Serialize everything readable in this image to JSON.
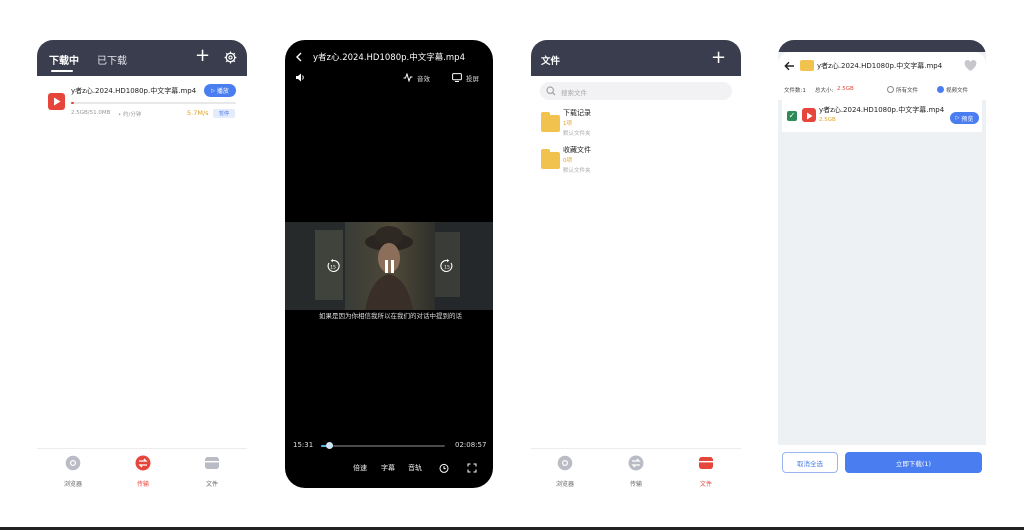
{
  "phone1": {
    "tabs": [
      "下载中",
      "已下载"
    ],
    "item": {
      "title": "y者z心.2024.HD1080p.中文字幕.mp4",
      "size": "2.5GB/51.0MB",
      "eta": "• 约/分钟",
      "speed": "5.7M/s",
      "play_label": "播放",
      "pause_label": "暂停",
      "progress": 0.02
    },
    "nav": [
      "浏览器",
      "传输",
      "文件"
    ]
  },
  "phone2": {
    "title": "y者z心.2024.HD1080p.中文字幕.mp4",
    "audio_label": "音效",
    "cast_label": "投屏",
    "subtitle": "如果是因为你相信我所以在我们的对话中提到的话",
    "current_time": "15:31",
    "total_time": "02:08:57",
    "progress": 0.07,
    "controls": [
      "倍速",
      "字幕",
      "音轨"
    ]
  },
  "phone3": {
    "title": "文件",
    "search_placeholder": "搜索文件",
    "folders": [
      {
        "name": "下载记录",
        "count": "1项",
        "sub": "默认文件夹"
      },
      {
        "name": "收藏文件",
        "count": "0项",
        "sub": "默认文件夹"
      }
    ],
    "nav": [
      "浏览器",
      "传输",
      "文件"
    ]
  },
  "phone4": {
    "title": "y者z心.2024.HD1080p.中文字幕.mp4",
    "file_count": "文件数:1",
    "total_size_label": "总大小:",
    "total_size": "2.5GB",
    "option_all": "所有文件",
    "option_video": "视频文件",
    "item": {
      "title": "y者z心.2024.HD1080p.中文字幕.mp4",
      "size": "2.5GB",
      "preview_label": "预览"
    },
    "cancel_label": "取消全选",
    "download_label": "立即下载(1)"
  },
  "colors": {
    "header": "#3a3d4d",
    "accent": "#4a7df0",
    "red": "#e6453c",
    "folder": "#f2c24f"
  }
}
